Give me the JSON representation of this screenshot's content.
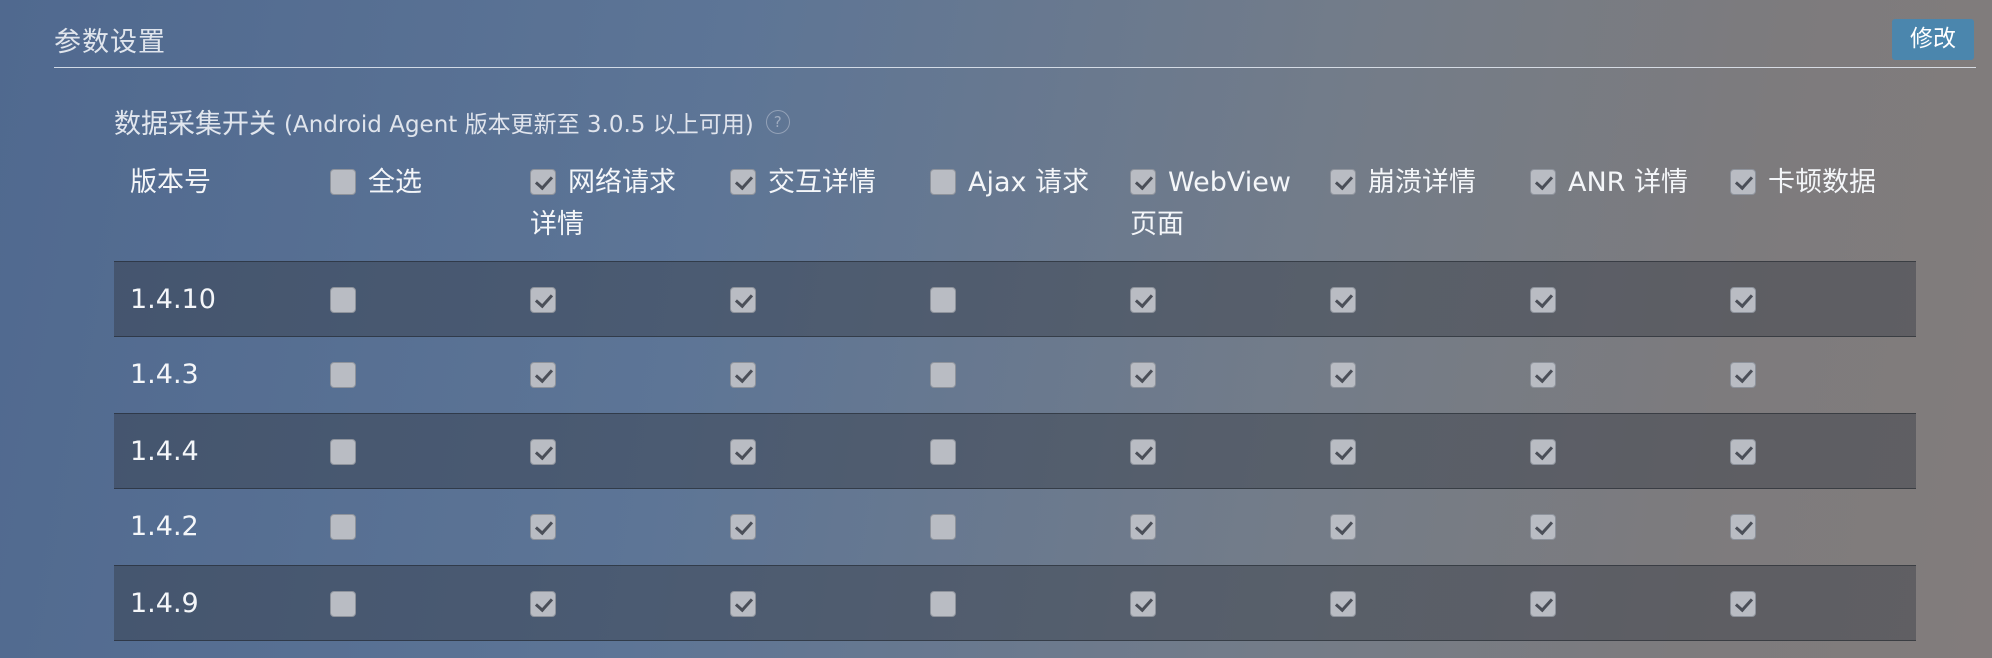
{
  "header": {
    "title": "参数设置",
    "edit_label": "修改"
  },
  "section": {
    "title": "数据采集开关",
    "note": "(Android Agent 版本更新至 3.0.5 以上可用)",
    "help_icon": "question-circle-icon",
    "help_glyph": "?"
  },
  "columns": [
    {
      "label": "版本号",
      "has_checkbox": false
    },
    {
      "label": "全选",
      "has_checkbox": true,
      "checked": false
    },
    {
      "label_line1": "网络请求",
      "label_line2": "详情",
      "has_checkbox": true,
      "checked": true
    },
    {
      "label": "交互详情",
      "has_checkbox": true,
      "checked": true
    },
    {
      "label": "Ajax 请求",
      "has_checkbox": true,
      "checked": false
    },
    {
      "label_line1": "WebView",
      "label_line2": "页面",
      "has_checkbox": true,
      "checked": true
    },
    {
      "label": "崩溃详情",
      "has_checkbox": true,
      "checked": true
    },
    {
      "label": "ANR 详情",
      "has_checkbox": true,
      "checked": true
    },
    {
      "label": "卡顿数据",
      "has_checkbox": true,
      "checked": true
    }
  ],
  "rows": [
    {
      "version": "1.4.10",
      "checks": [
        false,
        true,
        true,
        false,
        true,
        true,
        true,
        true
      ]
    },
    {
      "version": "1.4.3",
      "checks": [
        false,
        true,
        true,
        false,
        true,
        true,
        true,
        true
      ]
    },
    {
      "version": "1.4.4",
      "checks": [
        false,
        true,
        true,
        false,
        true,
        true,
        true,
        true
      ]
    },
    {
      "version": "1.4.2",
      "checks": [
        false,
        true,
        true,
        false,
        true,
        true,
        true,
        true
      ]
    },
    {
      "version": "1.4.9",
      "checks": [
        false,
        true,
        true,
        false,
        true,
        true,
        true,
        true
      ]
    }
  ],
  "colors": {
    "button": "#4b86ad",
    "checkbox": "#b9bcc3",
    "checkmark": "#4b4f58"
  }
}
